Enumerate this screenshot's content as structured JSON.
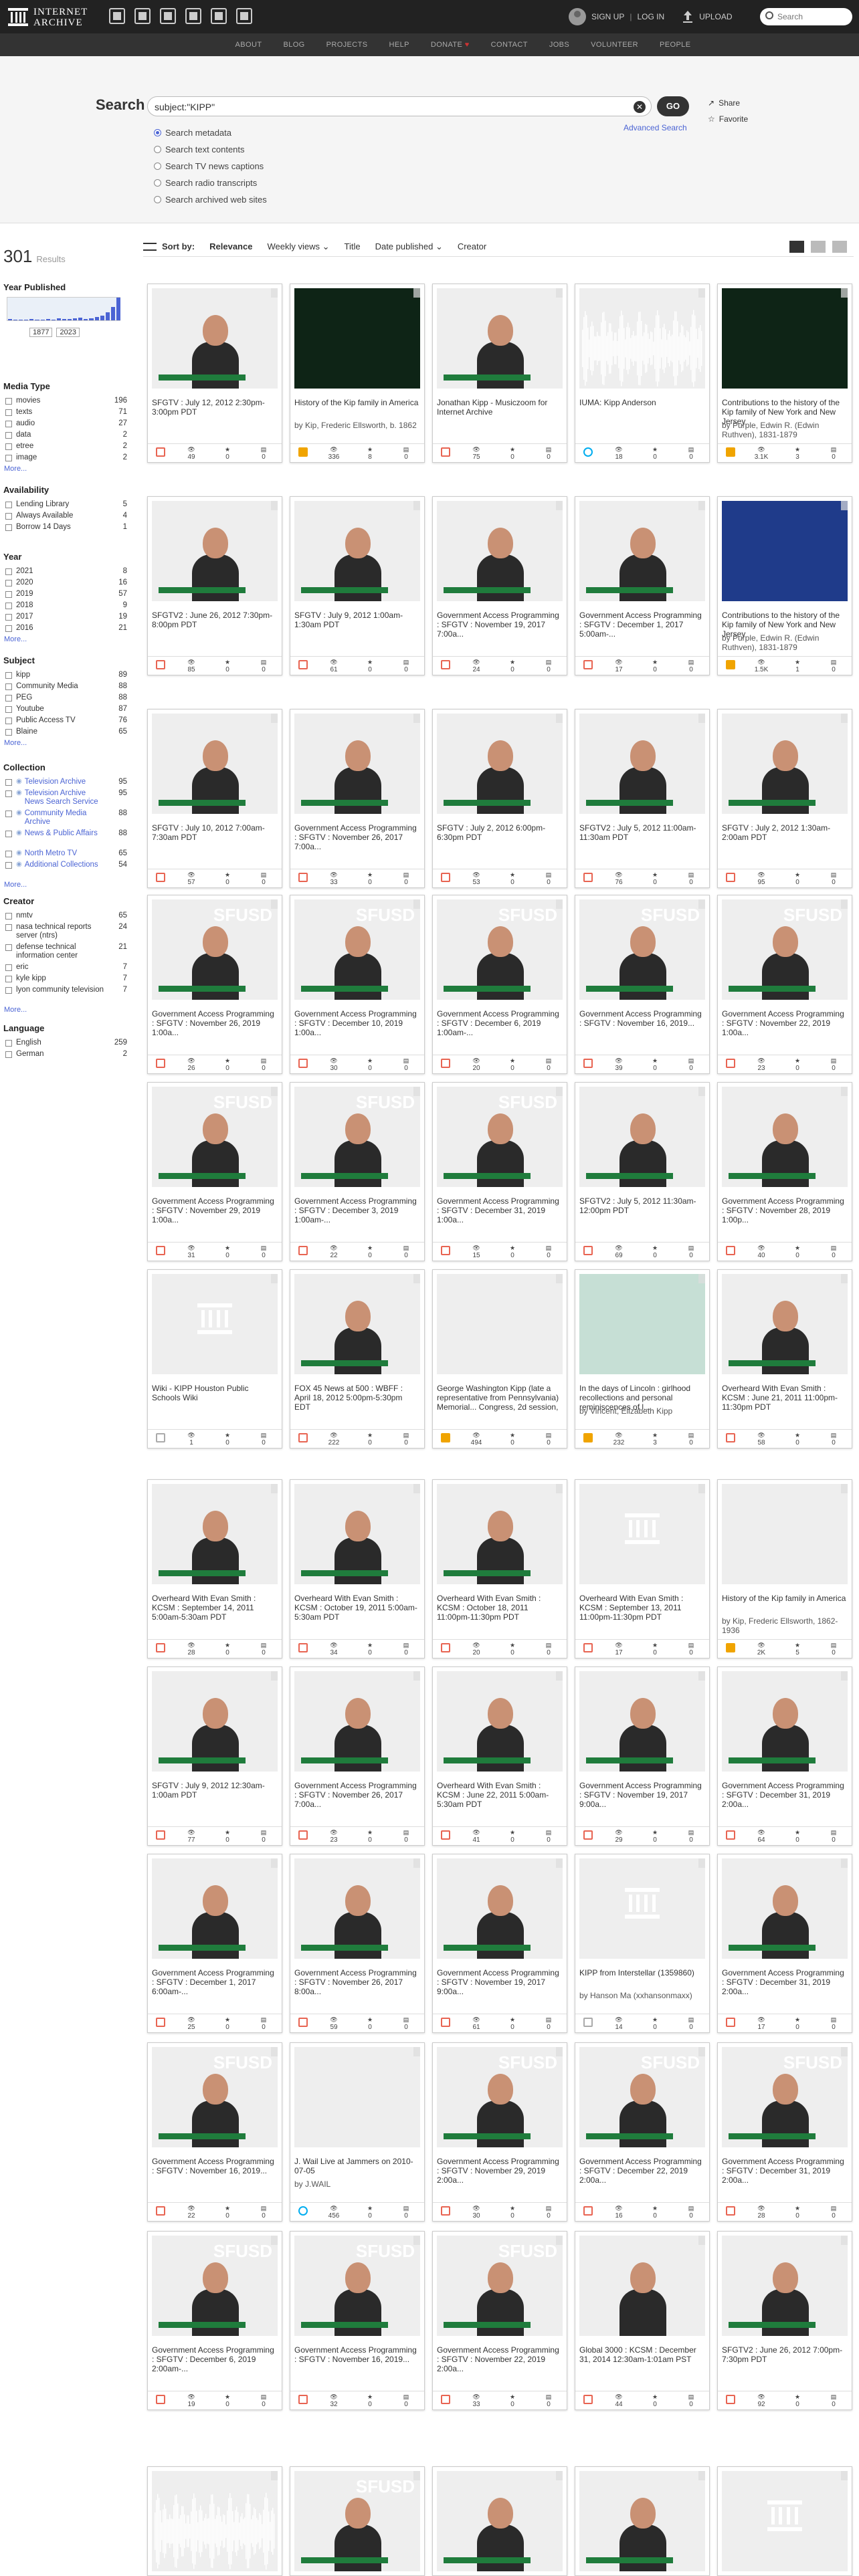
{
  "topnav": {
    "logo_line1": "INTERNET",
    "logo_line2": "ARCHIVE",
    "signup": "SIGN UP",
    "divider": "|",
    "login": "LOG IN",
    "upload": "UPLOAD",
    "search_placeholder": "Search"
  },
  "secnav": [
    "ABOUT",
    "BLOG",
    "PROJECTS",
    "HELP",
    "DONATE",
    "CONTACT",
    "JOBS",
    "VOLUNTEER",
    "PEOPLE"
  ],
  "secnav_heart": "♥",
  "search": {
    "label": "Search",
    "query": "subject:\"KIPP\"",
    "go": "GO",
    "share": "Share",
    "favorite": "Favorite",
    "advanced": "Advanced Search",
    "options": [
      "Search metadata",
      "Search text contents",
      "Search TV news captions",
      "Search radio transcripts",
      "Search archived web sites"
    ],
    "selected_option": "Search metadata"
  },
  "results": {
    "count": "301",
    "caption": "Results"
  },
  "sortbar": {
    "sort_by": "Sort by:",
    "options": [
      "Relevance",
      "Weekly views",
      "Title",
      "Date published",
      "Creator"
    ]
  },
  "sidebar": {
    "year_title": "Year Published",
    "year_from": "1877",
    "year_to": "2023",
    "year_bars": [
      0.05,
      0.03,
      0.02,
      0.04,
      0.06,
      0.03,
      0.02,
      0.05,
      0.04,
      0.08,
      0.06,
      0.05,
      0.09,
      0.12,
      0.07,
      0.1,
      0.15,
      0.2,
      0.35,
      0.6,
      1.0
    ],
    "facets": [
      {
        "title": "Media Type",
        "rows": [
          {
            "label": "movies",
            "count": "196"
          },
          {
            "label": "texts",
            "count": "71"
          },
          {
            "label": "audio",
            "count": "27"
          },
          {
            "label": "data",
            "count": "2"
          },
          {
            "label": "etree",
            "count": "2"
          },
          {
            "label": "image",
            "count": "2"
          }
        ],
        "more": "More..."
      },
      {
        "title": "Availability",
        "rows": [
          {
            "label": "Lending Library",
            "count": "5"
          },
          {
            "label": "Always Available",
            "count": "4"
          },
          {
            "label": "Borrow 14 Days",
            "count": "1"
          }
        ],
        "more": ""
      },
      {
        "title": "Year",
        "rows": [
          {
            "label": "2021",
            "count": "8"
          },
          {
            "label": "2020",
            "count": "16"
          },
          {
            "label": "2019",
            "count": "57"
          },
          {
            "label": "2018",
            "count": "9"
          },
          {
            "label": "2017",
            "count": "19"
          },
          {
            "label": "2016",
            "count": "21"
          }
        ],
        "more": "More..."
      },
      {
        "title": "Subject",
        "rows": [
          {
            "label": "kipp",
            "count": "89"
          },
          {
            "label": "Community Media",
            "count": "88"
          },
          {
            "label": "PEG",
            "count": "88"
          },
          {
            "label": "Youtube",
            "count": "87"
          },
          {
            "label": "Public Access TV",
            "count": "76"
          },
          {
            "label": "Blaine",
            "count": "65"
          }
        ],
        "more": "More..."
      },
      {
        "title": "Collection",
        "rows": [
          {
            "label": "Television Archive",
            "count": "95"
          },
          {
            "label": "Television Archive News Search Service",
            "count": "95"
          },
          {
            "label": "Community Media Archive",
            "count": "88"
          },
          {
            "label": "News & Public Affairs",
            "count": "88"
          },
          {
            "label": "North Metro TV",
            "count": "65"
          },
          {
            "label": "Additional Collections",
            "count": "54"
          }
        ],
        "more": "More..."
      },
      {
        "title": "Creator",
        "rows": [
          {
            "label": "nmtv",
            "count": "65"
          },
          {
            "label": "nasa technical reports server (ntrs)",
            "count": "24"
          },
          {
            "label": "defense technical information center",
            "count": "21"
          },
          {
            "label": "eric",
            "count": "7"
          },
          {
            "label": "kyle kipp",
            "count": "7"
          },
          {
            "label": "lyon community television",
            "count": "7"
          }
        ],
        "more": "More..."
      },
      {
        "title": "Language",
        "rows": [
          {
            "label": "English",
            "count": "259"
          },
          {
            "label": "German",
            "count": "2"
          }
        ],
        "more": ""
      }
    ]
  },
  "tiles": [
    {
      "title": "SFGTV : July 12, 2012 2:30pm-3:00pm PDT",
      "by": "",
      "type": "movie",
      "thumb": "video",
      "views": "49",
      "favs": "0",
      "reviews": "0"
    },
    {
      "title": "History of the Kip family in America",
      "by": "by Kip, Frederic Ellsworth, b. 1862",
      "type": "book",
      "thumb": "book-dark",
      "views": "336",
      "favs": "8",
      "reviews": "0"
    },
    {
      "title": "Jonathan Kipp - Musiczoom for Internet Archive",
      "by": "",
      "type": "movie",
      "thumb": "video",
      "views": "75",
      "favs": "0",
      "reviews": "0"
    },
    {
      "title": "IUMA: Kipp Anderson",
      "by": "",
      "type": "audio",
      "thumb": "wave",
      "views": "18",
      "favs": "0",
      "reviews": "0"
    },
    {
      "title": "Contributions to the history of the Kip family of New York and New Jersey",
      "by": "by Purple, Edwin R. (Edwin Ruthven), 1831-1879",
      "type": "book",
      "thumb": "book-dark",
      "views": "3.1K",
      "favs": "3",
      "reviews": "0"
    },
    {
      "title": "SFGTV2 : June 26, 2012 7:30pm-8:00pm PDT",
      "by": "",
      "type": "movie",
      "thumb": "video",
      "views": "85",
      "favs": "0",
      "reviews": "0"
    },
    {
      "title": "SFGTV : July 9, 2012 1:00am-1:30am PDT",
      "by": "",
      "type": "movie",
      "thumb": "video",
      "views": "61",
      "favs": "0",
      "reviews": "0"
    },
    {
      "title": "Government Access Programming : SFGTV : November 19, 2017 7:00a...",
      "by": "",
      "type": "movie",
      "thumb": "video",
      "views": "24",
      "favs": "0",
      "reviews": "0"
    },
    {
      "title": "Government Access Programming : SFGTV : December 1, 2017 5:00am-...",
      "by": "",
      "type": "movie",
      "thumb": "video",
      "views": "17",
      "favs": "0",
      "reviews": "0"
    },
    {
      "title": "Contributions to the history of the Kip family of New York and New Jersey",
      "by": "by Purple, Edwin R. (Edwin Ruthven), 1831-1879",
      "type": "book",
      "thumb": "book-blue",
      "views": "1.5K",
      "favs": "1",
      "reviews": "0"
    },
    {
      "title": "SFGTV : July 10, 2012 7:00am-7:30am PDT",
      "by": "",
      "type": "movie",
      "thumb": "video",
      "views": "57",
      "favs": "0",
      "reviews": "0"
    },
    {
      "title": "Government Access Programming : SFGTV : November 26, 2017 7:00a...",
      "by": "",
      "type": "movie",
      "thumb": "video",
      "views": "33",
      "favs": "0",
      "reviews": "0"
    },
    {
      "title": "SFGTV : July 2, 2012 6:00pm-6:30pm PDT",
      "by": "",
      "type": "movie",
      "thumb": "video",
      "views": "53",
      "favs": "0",
      "reviews": "0"
    },
    {
      "title": "SFGTV2 : July 5, 2012 11:00am-11:30am PDT",
      "by": "",
      "type": "movie",
      "thumb": "video",
      "views": "76",
      "favs": "0",
      "reviews": "0"
    },
    {
      "title": "SFGTV : July 2, 2012 1:30am-2:00am PDT",
      "by": "",
      "type": "movie",
      "thumb": "video",
      "views": "95",
      "favs": "0",
      "reviews": "0"
    },
    {
      "title": "Government Access Programming : SFGTV : November 26, 2019 1:00a...",
      "by": "",
      "type": "movie",
      "thumb": "sfusd",
      "views": "26",
      "favs": "0",
      "reviews": "0"
    },
    {
      "title": "Government Access Programming : SFGTV : December 10, 2019 1:00a...",
      "by": "",
      "type": "movie",
      "thumb": "sfusd",
      "views": "30",
      "favs": "0",
      "reviews": "0"
    },
    {
      "title": "Government Access Programming : SFGTV : December 6, 2019 1:00am-...",
      "by": "",
      "type": "movie",
      "thumb": "sfusd",
      "views": "20",
      "favs": "0",
      "reviews": "0"
    },
    {
      "title": "Government Access Programming : SFGTV : November 16, 2019...",
      "by": "",
      "type": "movie",
      "thumb": "sfusd",
      "views": "39",
      "favs": "0",
      "reviews": "0"
    },
    {
      "title": "Government Access Programming : SFGTV : November 22, 2019 1:00a...",
      "by": "",
      "type": "movie",
      "thumb": "sfusd",
      "views": "23",
      "favs": "0",
      "reviews": "0"
    },
    {
      "title": "Government Access Programming : SFGTV : November 29, 2019 1:00a...",
      "by": "",
      "type": "movie",
      "thumb": "sfusd",
      "views": "31",
      "favs": "0",
      "reviews": "0"
    },
    {
      "title": "Government Access Programming : SFGTV : December 3, 2019 1:00am-...",
      "by": "",
      "type": "movie",
      "thumb": "sfusd",
      "views": "22",
      "favs": "0",
      "reviews": "0"
    },
    {
      "title": "Government Access Programming : SFGTV : December 31, 2019 1:00a...",
      "by": "",
      "type": "movie",
      "thumb": "sfusd",
      "views": "15",
      "favs": "0",
      "reviews": "0"
    },
    {
      "title": "SFGTV2 : July 5, 2012 11:30am-12:00pm PDT",
      "by": "",
      "type": "movie",
      "thumb": "video",
      "views": "69",
      "favs": "0",
      "reviews": "0"
    },
    {
      "title": "Government Access Programming : SFGTV : November 28, 2019 1:00p...",
      "by": "",
      "type": "movie",
      "thumb": "video",
      "views": "40",
      "favs": "0",
      "reviews": "0"
    },
    {
      "title": "Wiki - KIPP Houston Public Schools Wiki",
      "by": "",
      "type": "data",
      "thumb": "black",
      "views": "1",
      "favs": "0",
      "reviews": "0"
    },
    {
      "title": "FOX 45 News at 500 : WBFF : April 18, 2012 5:00pm-5:30pm EDT",
      "by": "",
      "type": "movie",
      "thumb": "video",
      "views": "222",
      "favs": "0",
      "reviews": "0"
    },
    {
      "title": "George Washington Kipp (late a representative from Pennsylvania) Memorial... Congress, 2d session, 1911-1912",
      "by": "",
      "type": "book",
      "thumb": "book-darkgreen",
      "views": "494",
      "favs": "0",
      "reviews": "0"
    },
    {
      "title": "In the days of Lincoln : girlhood recollections and personal reminiscences of l...",
      "by": "by Vincent, Elizabeth Kipp",
      "type": "book",
      "thumb": "book-green",
      "views": "232",
      "favs": "3",
      "reviews": "0"
    },
    {
      "title": "Overheard With Evan Smith : KCSM : June 21, 2011 11:00pm-11:30pm PDT",
      "by": "",
      "type": "movie",
      "thumb": "video",
      "views": "58",
      "favs": "0",
      "reviews": "0"
    },
    {
      "title": "Overheard With Evan Smith : KCSM : September 14, 2011 5:00am-5:30am PDT",
      "by": "",
      "type": "movie",
      "thumb": "video",
      "views": "28",
      "favs": "0",
      "reviews": "0"
    },
    {
      "title": "Overheard With Evan Smith : KCSM : October 19, 2011 5:00am-5:30am PDT",
      "by": "",
      "type": "movie",
      "thumb": "video",
      "views": "34",
      "favs": "0",
      "reviews": "0"
    },
    {
      "title": "Overheard With Evan Smith : KCSM : October 18, 2011 11:00pm-11:30pm PDT",
      "by": "",
      "type": "movie",
      "thumb": "video",
      "views": "20",
      "favs": "0",
      "reviews": "0"
    },
    {
      "title": "Overheard With Evan Smith : KCSM : September 13, 2011 11:00pm-11:30pm PDT",
      "by": "",
      "type": "movie",
      "thumb": "black",
      "views": "17",
      "favs": "0",
      "reviews": "0"
    },
    {
      "title": "History of the Kip family in America",
      "by": "by Kip, Frederic Ellsworth, 1862-1936",
      "type": "book",
      "thumb": "book-mauve",
      "views": "2K",
      "favs": "5",
      "reviews": "0"
    },
    {
      "title": "SFGTV : July 9, 2012 12:30am-1:00am PDT",
      "by": "",
      "type": "movie",
      "thumb": "video",
      "views": "77",
      "favs": "0",
      "reviews": "0"
    },
    {
      "title": "Government Access Programming : SFGTV : November 26, 2017 7:00a...",
      "by": "",
      "type": "movie",
      "thumb": "video",
      "views": "23",
      "favs": "0",
      "reviews": "0"
    },
    {
      "title": "Overheard With Evan Smith : KCSM : June 22, 2011 5:00am-5:30am PDT",
      "by": "",
      "type": "movie",
      "thumb": "video",
      "views": "41",
      "favs": "0",
      "reviews": "0"
    },
    {
      "title": "Government Access Programming : SFGTV : November 19, 2017 9:00a...",
      "by": "",
      "type": "movie",
      "thumb": "video",
      "views": "29",
      "favs": "0",
      "reviews": "0"
    },
    {
      "title": "Government Access Programming : SFGTV : December 31, 2019 2:00a...",
      "by": "",
      "type": "movie",
      "thumb": "video",
      "views": "64",
      "favs": "0",
      "reviews": "0"
    },
    {
      "title": "Government Access Programming : SFGTV : December 1, 2017 6:00am-...",
      "by": "",
      "type": "movie",
      "thumb": "video",
      "views": "25",
      "favs": "0",
      "reviews": "0"
    },
    {
      "title": "Government Access Programming : SFGTV : November 26, 2017 8:00a...",
      "by": "",
      "type": "movie",
      "thumb": "video",
      "views": "59",
      "favs": "0",
      "reviews": "0"
    },
    {
      "title": "Government Access Programming : SFGTV : November 19, 2017 9:00a...",
      "by": "",
      "type": "movie",
      "thumb": "video",
      "views": "61",
      "favs": "0",
      "reviews": "0"
    },
    {
      "title": "KIPP from Interstellar (1359860)",
      "by": "by Hanson Ma (xxhansonmaxx)",
      "type": "folder",
      "thumb": "black",
      "views": "14",
      "favs": "0",
      "reviews": "0"
    },
    {
      "title": "Government Access Programming : SFGTV : December 31, 2019 2:00a...",
      "by": "",
      "type": "movie",
      "thumb": "video",
      "views": "17",
      "favs": "0",
      "reviews": "0"
    },
    {
      "title": "Government Access Programming : SFGTV : November 16, 2019...",
      "by": "",
      "type": "movie",
      "thumb": "sfusd",
      "views": "22",
      "favs": "0",
      "reviews": "0"
    },
    {
      "title": "J. Wail Live at Jammers on 2010-07-05",
      "by": "by J.WAIL",
      "type": "audio",
      "thumb": "red",
      "views": "456",
      "favs": "0",
      "reviews": "0"
    },
    {
      "title": "Government Access Programming : SFGTV : November 29, 2019 2:00a...",
      "by": "",
      "type": "movie",
      "thumb": "sfusd",
      "views": "30",
      "favs": "0",
      "reviews": "0"
    },
    {
      "title": "Government Access Programming : SFGTV : December 22, 2019 2:00a...",
      "by": "",
      "type": "movie",
      "thumb": "sfusd",
      "views": "16",
      "favs": "0",
      "reviews": "0"
    },
    {
      "title": "Government Access Programming : SFGTV : December 31, 2019 2:00a...",
      "by": "",
      "type": "movie",
      "thumb": "sfusd",
      "views": "28",
      "favs": "0",
      "reviews": "0"
    },
    {
      "title": "Government Access Programming : SFGTV : December 6, 2019 2:00am-...",
      "by": "",
      "type": "movie",
      "thumb": "sfusd",
      "views": "19",
      "favs": "0",
      "reviews": "0"
    },
    {
      "title": "Government Access Programming : SFGTV : November 16, 2019...",
      "by": "",
      "type": "movie",
      "thumb": "sfusd",
      "views": "32",
      "favs": "0",
      "reviews": "0"
    },
    {
      "title": "Government Access Programming : SFGTV : November 22, 2019 2:00a...",
      "by": "",
      "type": "movie",
      "thumb": "sfusd",
      "views": "33",
      "favs": "0",
      "reviews": "0"
    },
    {
      "title": "Global 3000 : KCSM : December 31, 2014 12:30am-1:01am PST",
      "by": "",
      "type": "movie",
      "thumb": "globe",
      "views": "44",
      "favs": "0",
      "reviews": "0"
    },
    {
      "title": "SFGTV2 : June 26, 2012 7:00pm-7:30pm PDT",
      "by": "",
      "type": "movie",
      "thumb": "video",
      "views": "92",
      "favs": "0",
      "reviews": "0"
    },
    {
      "title": "",
      "by": "",
      "type": "audio",
      "thumb": "audio",
      "views": "",
      "favs": "",
      "reviews": ""
    },
    {
      "title": "",
      "by": "",
      "type": "movie",
      "thumb": "sfusd",
      "views": "",
      "favs": "",
      "reviews": ""
    },
    {
      "title": "",
      "by": "",
      "type": "movie",
      "thumb": "video",
      "views": "",
      "favs": "",
      "reviews": ""
    },
    {
      "title": "",
      "by": "",
      "type": "movie",
      "thumb": "news",
      "views": "",
      "favs": "",
      "reviews": ""
    },
    {
      "title": "",
      "by": "",
      "type": "data",
      "thumb": "black",
      "views": "",
      "favs": "",
      "reviews": ""
    }
  ]
}
